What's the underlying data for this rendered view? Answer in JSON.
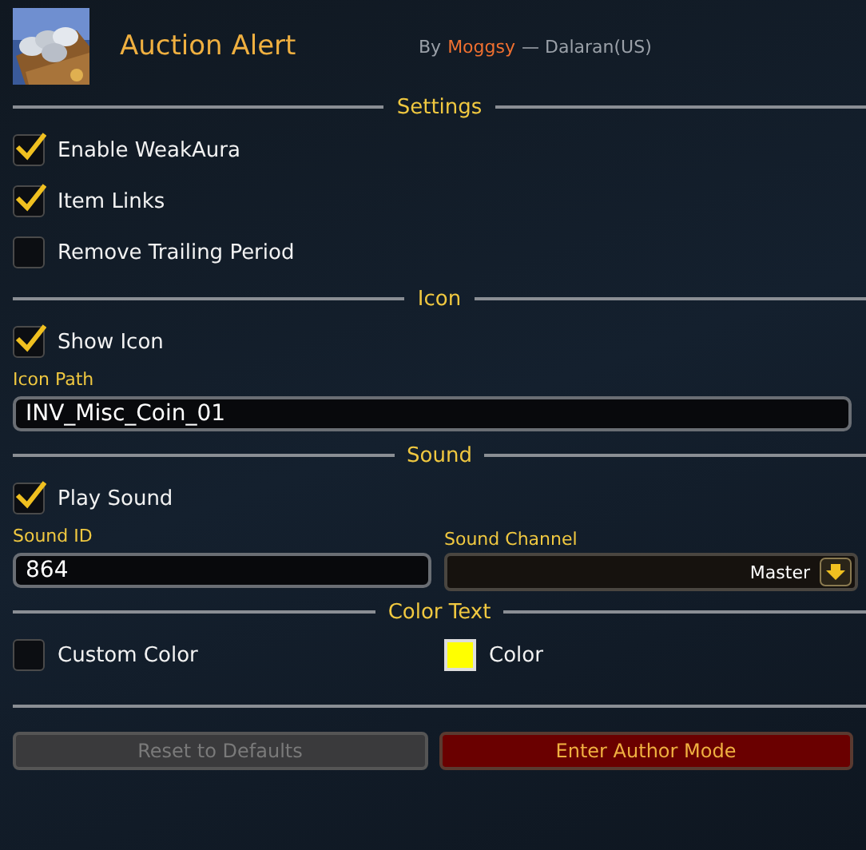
{
  "header": {
    "title": "Auction Alert",
    "by": "By",
    "author": "Moggsy",
    "realm": "— Dalaran(US)"
  },
  "sections": [
    {
      "title": "Settings",
      "rows": [
        {
          "kind": "checkbox",
          "label": "Enable WeakAura",
          "checked": true
        },
        {
          "kind": "checkbox",
          "label": "Item Links",
          "checked": true
        },
        {
          "kind": "checkbox",
          "label": "Remove Trailing Period",
          "checked": false
        }
      ]
    },
    {
      "title": "Icon",
      "rows": [
        {
          "kind": "checkbox",
          "label": "Show Icon",
          "checked": true
        },
        {
          "kind": "input",
          "label": "Icon Path",
          "value": "INV_Misc_Coin_01"
        }
      ]
    },
    {
      "title": "Sound",
      "rows": [
        {
          "kind": "checkbox",
          "label": "Play Sound",
          "checked": true
        },
        {
          "kind": "pair",
          "input": {
            "label": "Sound ID",
            "value": "864"
          },
          "dropdown": {
            "label": "Sound Channel",
            "value": "Master"
          }
        }
      ]
    },
    {
      "title": "Color Text",
      "rows": [
        {
          "kind": "colorpair",
          "checkbox": {
            "label": "Custom Color",
            "checked": false
          },
          "swatch": {
            "label": "Color",
            "color": "#ffff00"
          }
        }
      ]
    }
  ],
  "buttons": [
    {
      "label": "Reset to Defaults",
      "disabled": true
    },
    {
      "label": "Enter Author Mode",
      "disabled": false
    }
  ]
}
